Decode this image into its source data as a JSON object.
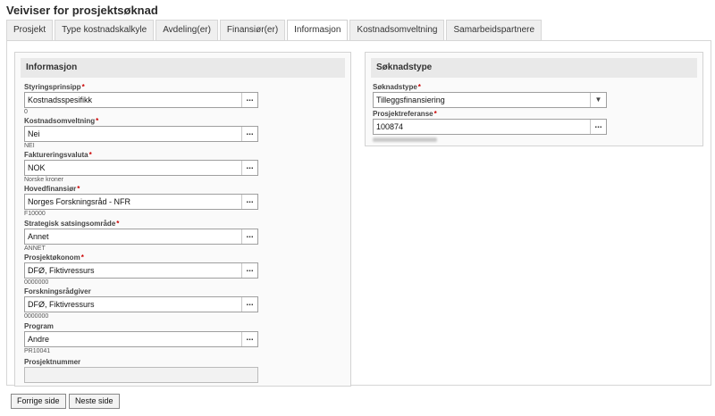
{
  "title": "Veiviser for prosjektsøknad",
  "tabs": [
    {
      "label": "Prosjekt"
    },
    {
      "label": "Type kostnadskalkyle"
    },
    {
      "label": "Avdeling(er)"
    },
    {
      "label": "Finansiør(er)"
    },
    {
      "label": "Informasjon"
    },
    {
      "label": "Kostnadsomveltning"
    },
    {
      "label": "Samarbeidspartnere"
    }
  ],
  "active_tab": "Informasjon",
  "left_panel": {
    "header": "Informasjon",
    "fields": [
      {
        "label": "Styringsprinsipp",
        "required": "*",
        "value": "Kostnadsspesifikk",
        "sub": "0"
      },
      {
        "label": "Kostnadsomveltning",
        "required": "*",
        "value": "Nei",
        "sub": "NEI"
      },
      {
        "label": "Faktureringsvaluta",
        "required": "*",
        "value": "NOK",
        "sub": "Norske kroner"
      },
      {
        "label": "Hovedfinansiør",
        "required": "*",
        "value": "Norges Forskningsråd - NFR",
        "sub": "F10000"
      },
      {
        "label": "Strategisk satsingsområde",
        "required": "*",
        "value": "Annet",
        "sub": "ANNET"
      },
      {
        "label": "Prosjektøkonom",
        "required": "*",
        "value": "DFØ, Fiktivressurs",
        "sub": "0000000"
      },
      {
        "label": "Forskningsrådgiver",
        "required": "",
        "value": "DFØ, Fiktivressurs",
        "sub": "0000000"
      },
      {
        "label": "Program",
        "required": "",
        "value": "Andre",
        "sub": "PR10041"
      }
    ],
    "last_field": {
      "label": "Prosjektnummer",
      "value": ""
    }
  },
  "right_panel": {
    "header": "Søknadstype",
    "soknadstype": {
      "label": "Søknadstype",
      "required": "*",
      "value": "Tilleggsfinansiering"
    },
    "prosjektreferanse": {
      "label": "Prosjektreferanse",
      "required": "*",
      "value": "100874"
    }
  },
  "buttons": {
    "prev": "Forrige side",
    "next": "Neste side"
  },
  "icons": {
    "lookup": "ellipsis-icon",
    "dropdown": "chevron-down-icon"
  },
  "dots_glyph": "...",
  "caret_glyph": "▼"
}
